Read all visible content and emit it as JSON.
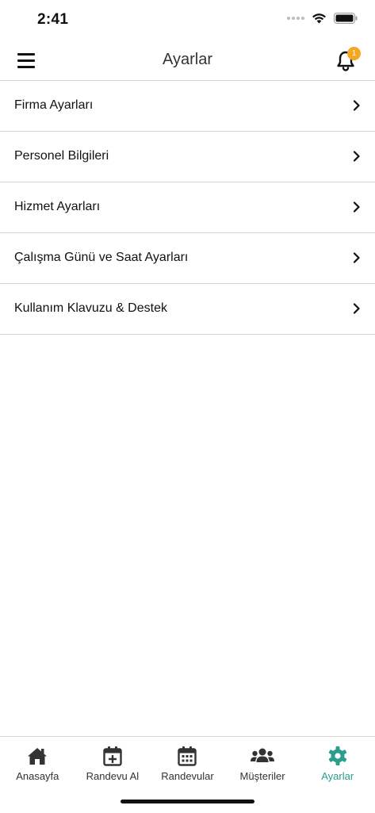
{
  "status_bar": {
    "time": "2:41"
  },
  "header": {
    "title": "Ayarlar",
    "notification_count": "1"
  },
  "settings": {
    "items": [
      {
        "label": "Firma Ayarları"
      },
      {
        "label": "Personel Bilgileri"
      },
      {
        "label": "Hizmet Ayarları"
      },
      {
        "label": "Çalışma Günü ve Saat Ayarları"
      },
      {
        "label": "Kullanım Klavuzu & Destek"
      }
    ]
  },
  "tabs": [
    {
      "label": "Anasayfa",
      "icon": "home-icon"
    },
    {
      "label": "Randevu Al",
      "icon": "calendar-plus-icon"
    },
    {
      "label": "Randevular",
      "icon": "calendar-icon"
    },
    {
      "label": "Müşteriler",
      "icon": "users-icon"
    },
    {
      "label": "Ayarlar",
      "icon": "gear-icon",
      "active": true
    }
  ],
  "colors": {
    "accent": "#2a9d8f",
    "badge": "#f5a623",
    "inactive": "#333333"
  }
}
